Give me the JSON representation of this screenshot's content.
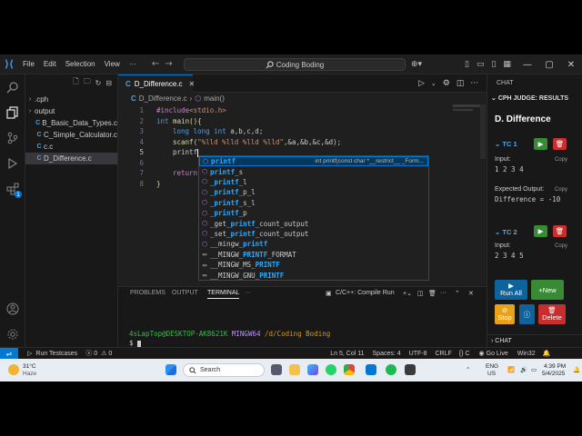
{
  "menu": [
    "File",
    "Edit",
    "Selection",
    "View",
    "···"
  ],
  "search": {
    "text": "Coding Boding"
  },
  "explorer": {
    "items": [
      {
        "label": ".cph",
        "kind": "folder"
      },
      {
        "label": "output",
        "kind": "folder"
      },
      {
        "label": "B_Basic_Data_Types.c",
        "kind": "file"
      },
      {
        "label": "C_Simple_Calculator.c",
        "kind": "file"
      },
      {
        "label": "c.c",
        "kind": "file"
      },
      {
        "label": "D_Difference.c",
        "kind": "file",
        "selected": true
      }
    ]
  },
  "editor": {
    "tab": "D_Difference.c",
    "breadcrumb": {
      "file": "D_Difference.c",
      "symbol": "main()"
    },
    "line_numbers": [
      "1",
      "2",
      "3",
      "4",
      "5",
      "6",
      "7",
      "8"
    ],
    "code": {
      "l1_pp": "#include",
      "l1_hdr": "<stdio.h>",
      "l2_int": "int",
      "l2_fn": " main(){",
      "l3_kw": "long long int",
      "l3_rest": " a,b,c,d;",
      "l4_fn": "scanf",
      "l4_open": "(",
      "l4_str": "\"%lld %lld %lld %lld\"",
      "l4_rest": ",&a,&b,&c,&d);",
      "l5_typed": "printf",
      "l7_kw": "return",
      "l8_close": "}"
    }
  },
  "suggest": {
    "items": [
      {
        "pre": "",
        "hl": "printf",
        "post": "",
        "icon": "cube",
        "detail": "int printf(const char *__restrict__ _Form..."
      },
      {
        "pre": "",
        "hl": "printf",
        "post": "_s",
        "icon": "cube"
      },
      {
        "pre": "_",
        "hl": "printf",
        "post": "_l",
        "icon": "cube"
      },
      {
        "pre": "_",
        "hl": "printf",
        "post": "_p_l",
        "icon": "cube"
      },
      {
        "pre": "_",
        "hl": "printf",
        "post": "_s_l",
        "icon": "cube"
      },
      {
        "pre": "_",
        "hl": "printf",
        "post": "_p",
        "icon": "cube"
      },
      {
        "pre": "_get_",
        "hl": "printf",
        "post": "_count_output",
        "icon": "cube"
      },
      {
        "pre": "_set_",
        "hl": "printf",
        "post": "_count_output",
        "icon": "cube"
      },
      {
        "pre": "__mingw_",
        "hl": "printf",
        "post": "",
        "icon": "cube"
      },
      {
        "pre": "__MINGW_",
        "hl": "PRINTF",
        "post": "_FORMAT",
        "icon": "box"
      },
      {
        "pre": "__MINGW_MS_",
        "hl": "PRINTF",
        "post": "",
        "icon": "box"
      },
      {
        "pre": "__MINGW_GNU_",
        "hl": "PRINTF",
        "post": "",
        "icon": "box"
      }
    ]
  },
  "panel": {
    "tabs": [
      "PROBLEMS",
      "OUTPUT",
      "TERMINAL",
      "···"
    ],
    "terminal_name": "C/C++: Compile Run",
    "prompt_user": "4sLapTop@DESKTOP-AK8621K",
    "prompt_env": "MINGW64",
    "prompt_path": "/d/Coding Boding",
    "prompt_symbol": "$"
  },
  "cph": {
    "header": "CHAT",
    "section": "CPH JUDGE: RESULTS",
    "problem": "D. Difference",
    "tc1": {
      "label": "TC 1",
      "input_label": "Input:",
      "input": "1 2 3 4",
      "expected_label": "Expected Output:",
      "expected": "Difference = -10",
      "copy": "Copy"
    },
    "tc2": {
      "label": "TC 2",
      "input_label": "Input:",
      "input": "2 3 4 5",
      "copy": "Copy"
    },
    "buttons": {
      "run_all": "Run All",
      "new": "New",
      "stop": "Stop",
      "delete": "Delete"
    },
    "footer": "CHAT"
  },
  "status": {
    "run": "Run Testcases",
    "errors": "0",
    "warnings": "0",
    "position": "Ln 5, Col 11",
    "spaces": "Spaces: 4",
    "encoding": "UTF-8",
    "eol": "CRLF",
    "lang": "C",
    "golive": "Go Live",
    "platform": "Win32"
  },
  "taskbar": {
    "weather_temp": "31°C",
    "weather_desc": "Haze",
    "search": "Search",
    "lang1": "ENG",
    "lang2": "US",
    "time": "4:39 PM",
    "date": "5/4/2025"
  },
  "colors": {
    "accent": "#0078d4",
    "green": "#388a34",
    "red": "#c72e2e",
    "orange": "#e8a21a",
    "blue": "#0e639c"
  }
}
